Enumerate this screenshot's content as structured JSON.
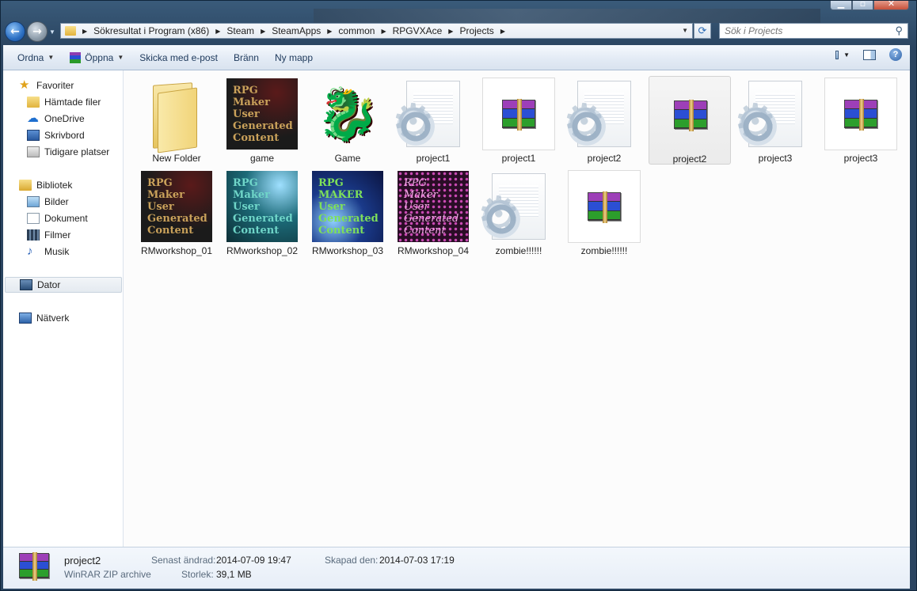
{
  "address": {
    "crumbs": [
      "Sökresultat i Program (x86)",
      "Steam",
      "SteamApps",
      "common",
      "RPGVXAce",
      "Projects"
    ]
  },
  "search": {
    "placeholder": "Sök i Projects"
  },
  "toolbar": {
    "organize": "Ordna",
    "open": "Öppna",
    "email": "Skicka med e-post",
    "burn": "Bränn",
    "new_folder": "Ny mapp"
  },
  "navpane": {
    "favorites": "Favoriter",
    "downloads": "Hämtade filer",
    "onedrive": "OneDrive",
    "desktop": "Skrivbord",
    "recent": "Tidigare platser",
    "libraries": "Bibliotek",
    "pictures": "Bilder",
    "documents": "Dokument",
    "videos": "Filmer",
    "music": "Musik",
    "computer": "Dator",
    "network": "Nätverk"
  },
  "files": [
    {
      "name": "New Folder",
      "kind": "folder"
    },
    {
      "name": "game",
      "kind": "rpgmaker-image"
    },
    {
      "name": "Game",
      "kind": "dragon-icon"
    },
    {
      "name": "project1",
      "kind": "config-file"
    },
    {
      "name": "project1",
      "kind": "winrar-zip"
    },
    {
      "name": "project2",
      "kind": "config-file"
    },
    {
      "name": "project2",
      "kind": "winrar-zip",
      "selected": true
    },
    {
      "name": "project3",
      "kind": "config-file"
    },
    {
      "name": "project3",
      "kind": "winrar-zip"
    },
    {
      "name": "RMworkshop_01",
      "kind": "rpgmaker-image"
    },
    {
      "name": "RMworkshop_02",
      "kind": "rpgmaker-image"
    },
    {
      "name": "RMworkshop_03",
      "kind": "rpgmaker-image"
    },
    {
      "name": "RMworkshop_04",
      "kind": "rpgmaker-image"
    },
    {
      "name": "zombie!!!!!!",
      "kind": "config-file"
    },
    {
      "name": "zombie!!!!!!",
      "kind": "winrar-zip"
    }
  ],
  "thumb_text": {
    "rpg": "RPG",
    "maker": "Maker",
    "maker_caps": "MAKER",
    "user": "User",
    "generated": "Generated",
    "content": "Content"
  },
  "details": {
    "name": "project2",
    "type": "WinRAR ZIP archive",
    "modified_label": "Senast ändrad:",
    "modified_value": "2014-07-09 19:47",
    "size_label": "Storlek:",
    "size_value": "39,1 MB",
    "created_label": "Skapad den:",
    "created_value": "2014-07-03 17:19"
  },
  "colors": {
    "selection_bg": "#ebebeb",
    "toolbar_text": "#1e395b",
    "window_frame": "#2a4460"
  }
}
